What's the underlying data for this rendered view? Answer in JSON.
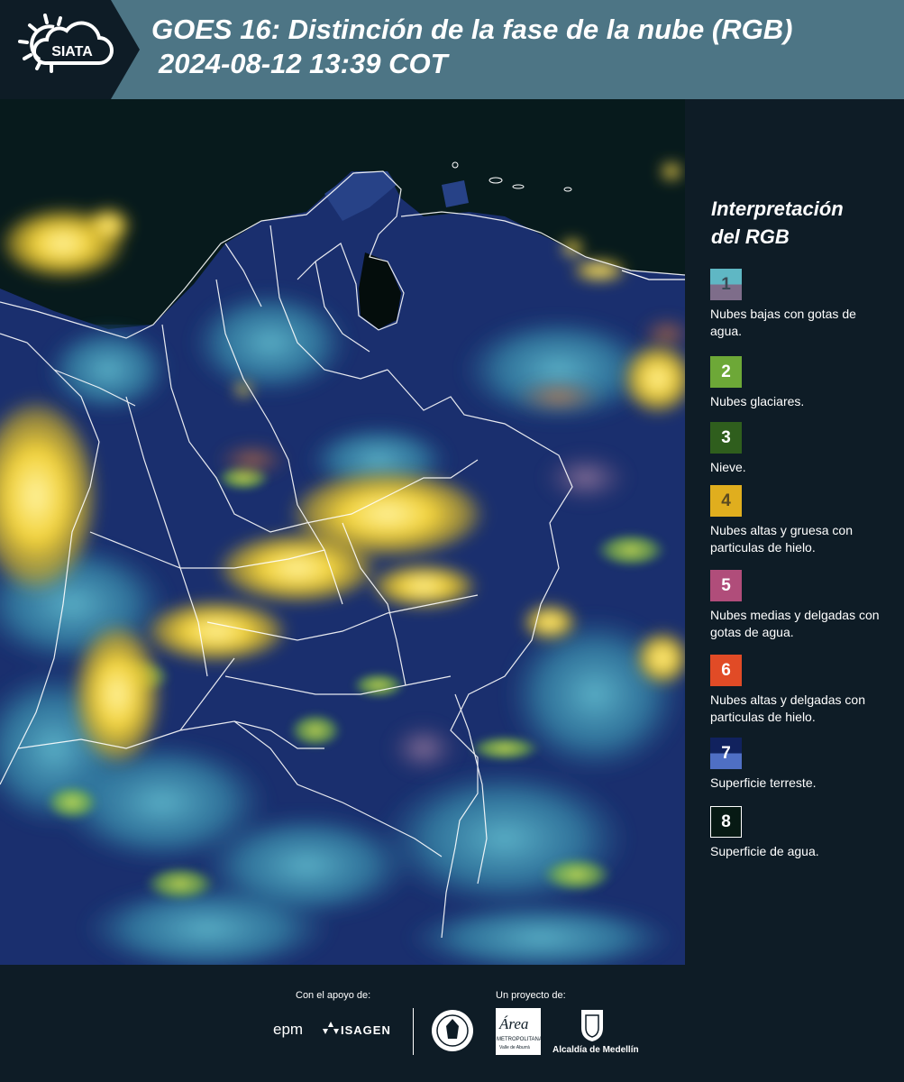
{
  "header": {
    "logo_text": "SIATA",
    "title_line1": "GOES 16: Distinción de la fase de la nube (RGB)",
    "title_line2": "2024-08-12 13:39 COT"
  },
  "legend": {
    "title_line1": "Interpretación",
    "title_line2": "del RGB",
    "items": [
      {
        "num": "1",
        "label": "Nubes bajas con gotas de agua.",
        "color_top": "#5fb7c4",
        "color_bottom": "#7e6d8a",
        "num_color": "#3a4a55"
      },
      {
        "num": "2",
        "label": "Nubes glaciares.",
        "color_top": "#6da837",
        "color_bottom": "#6da837",
        "num_color": "#ffffff"
      },
      {
        "num": "3",
        "label": "Nieve.",
        "color_top": "#2f5e1d",
        "color_bottom": "#2f5e1d",
        "num_color": "#ffffff"
      },
      {
        "num": "4",
        "label": "Nubes altas y gruesa con particulas de hielo.",
        "color_top": "#e0ae1e",
        "color_bottom": "#e0ae1e",
        "num_color": "#5a4a20"
      },
      {
        "num": "5",
        "label": "Nubes medias y delgadas con gotas de agua.",
        "color_top": "#b04d7a",
        "color_bottom": "#b04d7a",
        "num_color": "#ffffff"
      },
      {
        "num": "6",
        "label": "Nubes altas y delgadas con particulas de hielo.",
        "color_top": "#e14b26",
        "color_bottom": "#e14b26",
        "num_color": "#ffffff"
      },
      {
        "num": "7",
        "label": "Superficie terreste.",
        "color_top": "#11225e",
        "color_bottom": "#4f6fc4",
        "num_color": "#ffffff"
      },
      {
        "num": "8",
        "label": "Superficie de agua.",
        "color_top": "#071a14",
        "color_bottom": "#071a14",
        "num_color": "#ffffff"
      }
    ]
  },
  "footer": {
    "support_label": "Con el apoyo de:",
    "project_label": "Un proyecto de:",
    "brand_epm": "epm",
    "brand_isagen": "ISAGEN",
    "brand_area": "Área",
    "brand_area_sub": "METROPOLITANA",
    "brand_area_sub2": "Valle de Aburrá",
    "brand_alcaldia": "Alcaldía de Medellín"
  }
}
